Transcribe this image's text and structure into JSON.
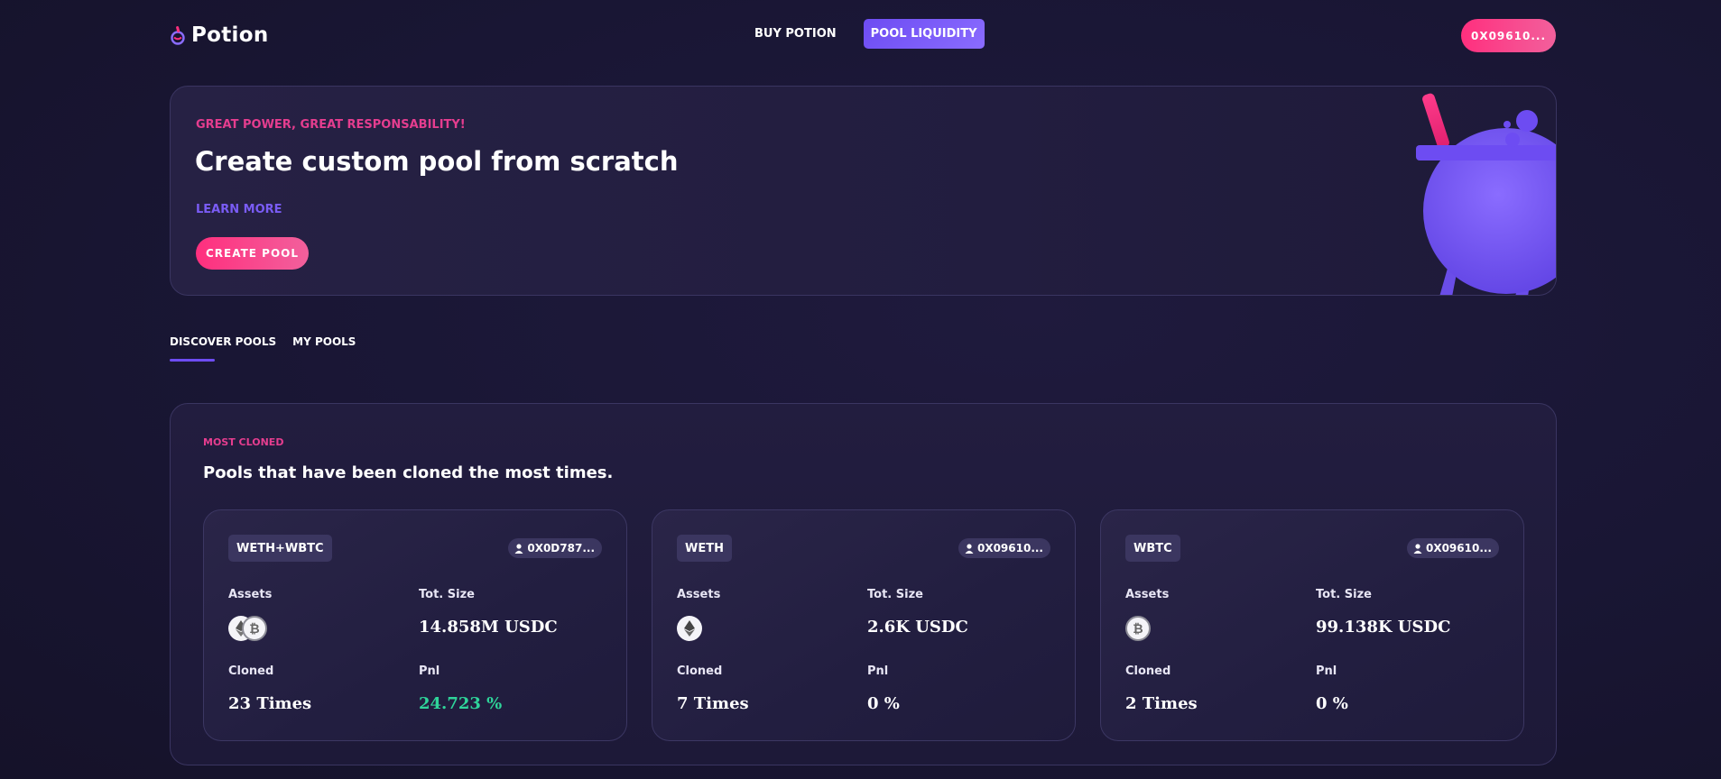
{
  "app": {
    "logo_text": "Potion"
  },
  "nav": {
    "items": [
      {
        "label": "BUY POTION",
        "active": false
      },
      {
        "label": "POOL LIQUIDITY",
        "active": true
      }
    ]
  },
  "wallet": {
    "label": "0X09610..."
  },
  "hero": {
    "kicker": "GREAT POWER, GREAT RESPONSABILITY!",
    "title": "Create custom pool from scratch",
    "learn_more": "LEARN MORE",
    "create_button": "CREATE POOL"
  },
  "tabs": [
    {
      "label": "DISCOVER POOLS",
      "active": true
    },
    {
      "label": "MY POOLS",
      "active": false
    }
  ],
  "section": {
    "kicker": "MOST CLONED",
    "title": "Pools that have been cloned the most times.",
    "labels": {
      "assets": "Assets",
      "size": "Tot. Size",
      "cloned": "Cloned",
      "pnl": "Pnl"
    },
    "cards": [
      {
        "name": "WETH+WBTC",
        "owner": "0X0D787...",
        "assets": [
          "eth-icon",
          "btc-icon"
        ],
        "size": "14.858M USDC",
        "cloned": "23 Times",
        "pnl": "24.723 %",
        "pnl_positive": true
      },
      {
        "name": "WETH",
        "owner": "0X09610...",
        "assets": [
          "eth-icon"
        ],
        "size": "2.6K USDC",
        "cloned": "7 Times",
        "pnl": "0 %",
        "pnl_positive": false
      },
      {
        "name": "WBTC",
        "owner": "0X09610...",
        "assets": [
          "btc-icon"
        ],
        "size": "99.138K USDC",
        "cloned": "2 Times",
        "pnl": "0 %",
        "pnl_positive": false
      }
    ]
  },
  "colors": {
    "accent_pink": "#ff2f7e",
    "accent_purple": "#6d4cf2",
    "positive_green": "#2fd49a",
    "background": "#191634"
  }
}
